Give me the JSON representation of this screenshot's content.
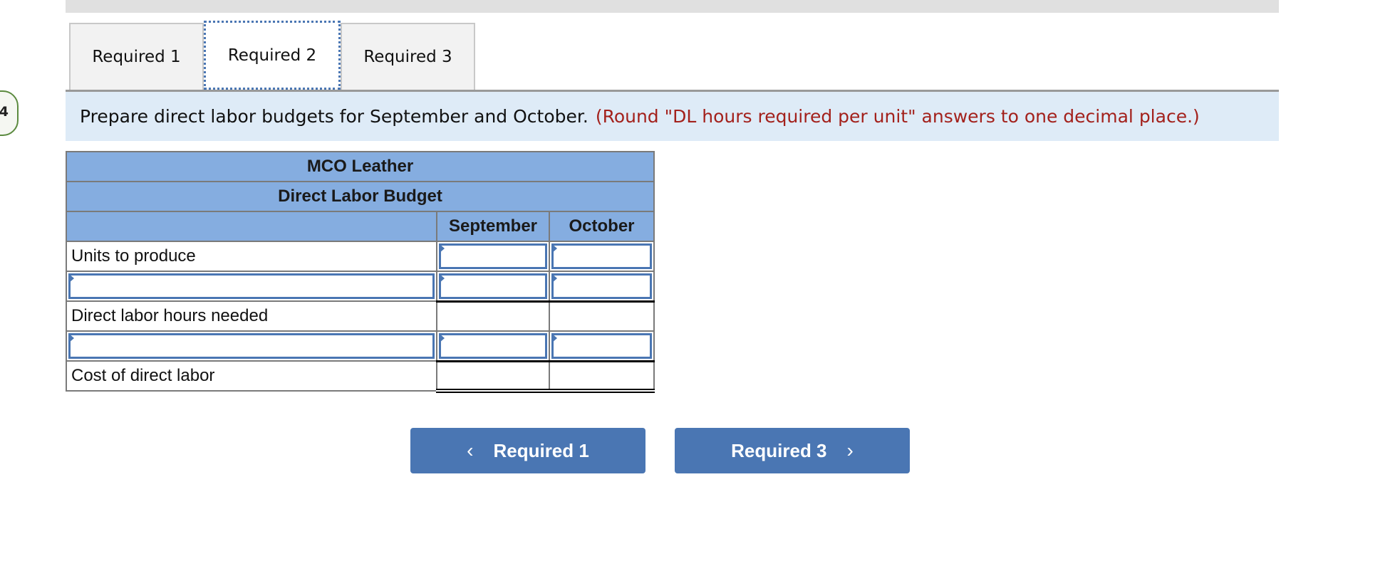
{
  "question_number": "4",
  "tabs": [
    {
      "label": "Required 1",
      "active": false
    },
    {
      "label": "Required 2",
      "active": true
    },
    {
      "label": "Required 3",
      "active": false
    }
  ],
  "instruction": {
    "text": "Prepare direct labor budgets for September and October.",
    "note": "(Round \"DL hours required per unit\" answers to one decimal place.)"
  },
  "table": {
    "company": "MCO Leather",
    "title": "Direct Labor Budget",
    "columns": [
      "September",
      "October"
    ],
    "rows": [
      {
        "label": "Units to produce",
        "label_editable": false,
        "values": [
          "",
          ""
        ],
        "values_editable": true
      },
      {
        "label": "",
        "label_editable": true,
        "values": [
          "",
          ""
        ],
        "values_editable": true
      },
      {
        "label": "Direct labor hours needed",
        "label_editable": false,
        "values": [
          "",
          ""
        ],
        "values_editable": false
      },
      {
        "label": "",
        "label_editable": true,
        "values": [
          "",
          ""
        ],
        "values_editable": true
      },
      {
        "label": "Cost of direct labor",
        "label_editable": false,
        "values": [
          "",
          ""
        ],
        "values_editable": false
      }
    ]
  },
  "nav": {
    "prev_label": "Required 1",
    "next_label": "Required 3",
    "prev_icon": "chevron-left-icon",
    "next_icon": "chevron-right-icon"
  },
  "colors": {
    "accent": "#4a76b3",
    "header_bg": "#85ade0",
    "instruction_bg": "#deebf7",
    "note_color": "#a3211c",
    "badge_border": "#5b8a3f"
  }
}
